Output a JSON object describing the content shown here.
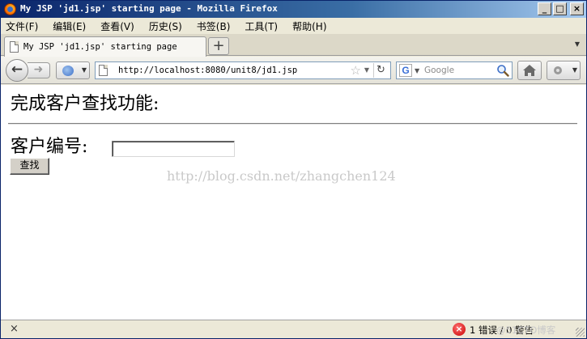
{
  "window": {
    "title": "My JSP 'jd1.jsp' starting page - Mozilla Firefox",
    "controls": {
      "minimize": "_",
      "maximize": "□",
      "close": "×"
    }
  },
  "menubar": {
    "items": [
      "文件(F)",
      "编辑(E)",
      "查看(V)",
      "历史(S)",
      "书签(B)",
      "工具(T)",
      "帮助(H)"
    ]
  },
  "tabs": {
    "items": [
      {
        "label": "My JSP 'jd1.jsp' starting page"
      }
    ],
    "new_tab": "+"
  },
  "navbar": {
    "url": "http://localhost:8080/unit8/jd1.jsp",
    "search_placeholder": "Google",
    "search_engine": "G"
  },
  "page": {
    "heading": "完成客户查找功能:",
    "field_label": "客户编号:",
    "field_value": "",
    "button_label": "查找",
    "watermark": "http://blog.csdn.net/zhangchen124"
  },
  "statusbar": {
    "close": "×",
    "error_badge": "×",
    "errors_text": "1 错误 / 0 警告",
    "watermark": "@51CTO博客"
  },
  "colors": {
    "titlebar_start": "#0a246a",
    "titlebar_end": "#a6caf0",
    "chrome": "#ece9d8",
    "error": "#c80000"
  },
  "icons": [
    "firefox-logo-icon",
    "back-arrow-icon",
    "forward-arrow-icon",
    "page-icon",
    "bookmark-star-icon",
    "reload-icon",
    "google-icon",
    "magnifier-icon",
    "home-icon",
    "addon-icon",
    "error-icon"
  ]
}
